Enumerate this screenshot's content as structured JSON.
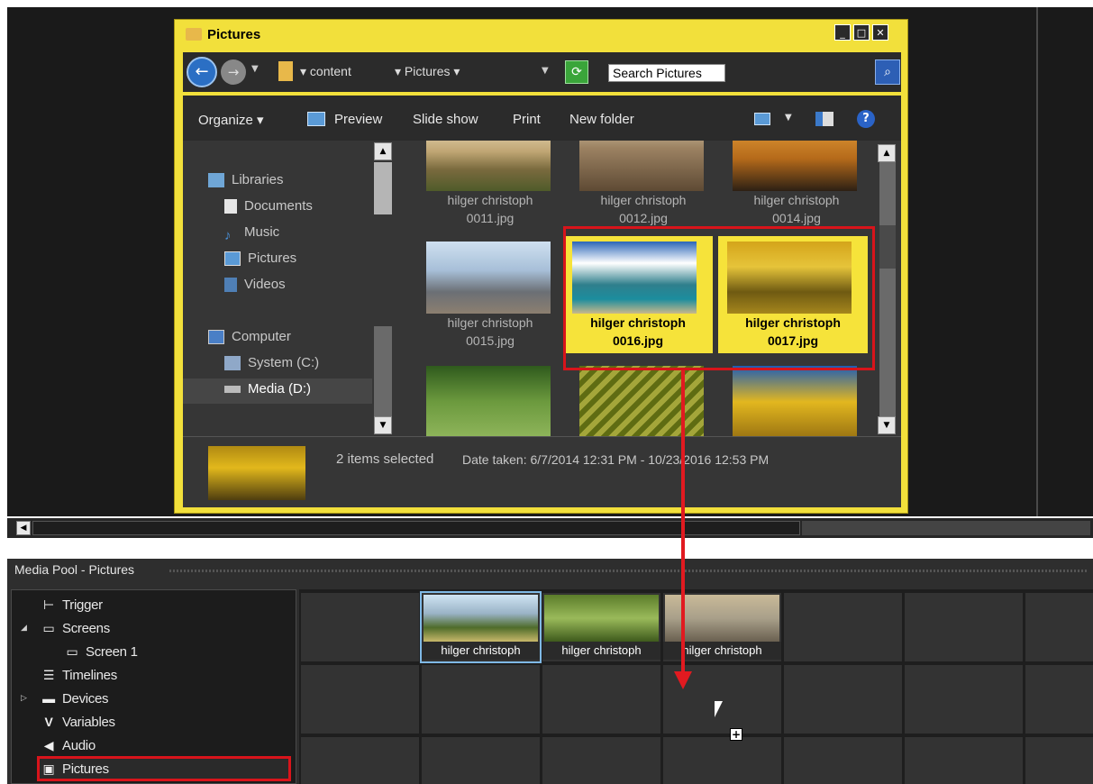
{
  "explorer": {
    "title": "Pictures",
    "window_buttons": {
      "minimize": "_",
      "maximize": "□",
      "close": "✕"
    },
    "address": {
      "crumb1": "▾  content",
      "crumb2": "▾  Pictures  ▾",
      "search_placeholder": "Search Pictures"
    },
    "toolbar": {
      "organize": "Organize  ▾",
      "preview": "Preview",
      "slideshow": "Slide show",
      "print": "Print",
      "new_folder": "New folder"
    },
    "nav": {
      "libraries": "Libraries",
      "documents": "Documents",
      "music": "Music",
      "pictures": "Pictures",
      "videos": "Videos",
      "computer": "Computer",
      "system": "System (C:)",
      "media": "Media (D:)"
    },
    "files": [
      {
        "name": "hilger christoph 0011.jpg",
        "line1": "hilger christoph",
        "line2": "0011.jpg",
        "selected": false
      },
      {
        "name": "hilger christoph 0012.jpg",
        "line1": "hilger christoph",
        "line2": "0012.jpg",
        "selected": false
      },
      {
        "name": "hilger christoph 0014.jpg",
        "line1": "hilger christoph",
        "line2": "0014.jpg",
        "selected": false
      },
      {
        "name": "hilger christoph 0015.jpg",
        "line1": "hilger christoph",
        "line2": "0015.jpg",
        "selected": false
      },
      {
        "name": "hilger christoph 0016.jpg",
        "line1": "hilger christoph",
        "line2": "0016.jpg",
        "selected": true
      },
      {
        "name": "hilger christoph 0017.jpg",
        "line1": "hilger christoph",
        "line2": "0017.jpg",
        "selected": true
      }
    ],
    "details": {
      "selection_count": "2 items selected",
      "date_taken": "Date taken: 6/7/2014 12:31 PM - 10/23/2016 12:53 PM"
    }
  },
  "media_pool": {
    "title": "Media Pool - Pictures",
    "tree": {
      "trigger": "Trigger",
      "screens": "Screens",
      "screen1": "Screen 1",
      "timelines": "Timelines",
      "devices": "Devices",
      "variables": "Variables",
      "audio": "Audio",
      "pictures": "Pictures"
    },
    "items": [
      {
        "label": "hilger christoph",
        "active": true
      },
      {
        "label": "hilger christoph",
        "active": false
      },
      {
        "label": "hilger christoph",
        "active": false
      }
    ]
  },
  "colors": {
    "explorer_frame": "#f2e03b",
    "selection_highlight": "#f6e33a",
    "annotation_red": "#e11a20",
    "dark_bg": "#1a1a1a"
  }
}
